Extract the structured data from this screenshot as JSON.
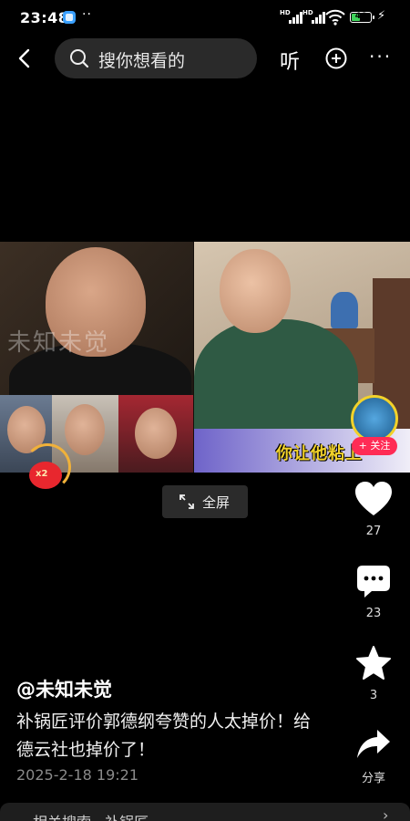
{
  "status_bar": {
    "time": "23:48",
    "notif_dots": "··",
    "signal1_label": "HD",
    "signal2_label": "HD",
    "battery": "46",
    "icons": [
      "app-icon",
      "signal-icon",
      "signal-icon",
      "wifi-icon",
      "battery-icon",
      "charging-icon"
    ]
  },
  "nav": {
    "search_placeholder": "搜你想看的",
    "listen_label": "听",
    "icons": [
      "back-icon",
      "search-icon",
      "plus-circle-icon",
      "more-icon"
    ]
  },
  "video": {
    "watermark": "未知未觉",
    "caption": "你让他粘上",
    "follow_label": "+ 关注",
    "redpack_label": "x2"
  },
  "fullscreen_label": "全屏",
  "actions": {
    "likes": "27",
    "comments": "23",
    "favorites": "3",
    "share_label": "分享"
  },
  "post": {
    "author": "@未知未觉",
    "description": "补锅匠评价郭德纲夸赞的人太掉价！给德云社也掉价了！",
    "date": "2025-2-18 19:21"
  },
  "related": {
    "label": "相关搜索 · 补锅匠"
  },
  "colors": {
    "background": "#000000",
    "like": "#ffffff",
    "follow": "#ff2b55",
    "caption": "#f2d22a"
  }
}
